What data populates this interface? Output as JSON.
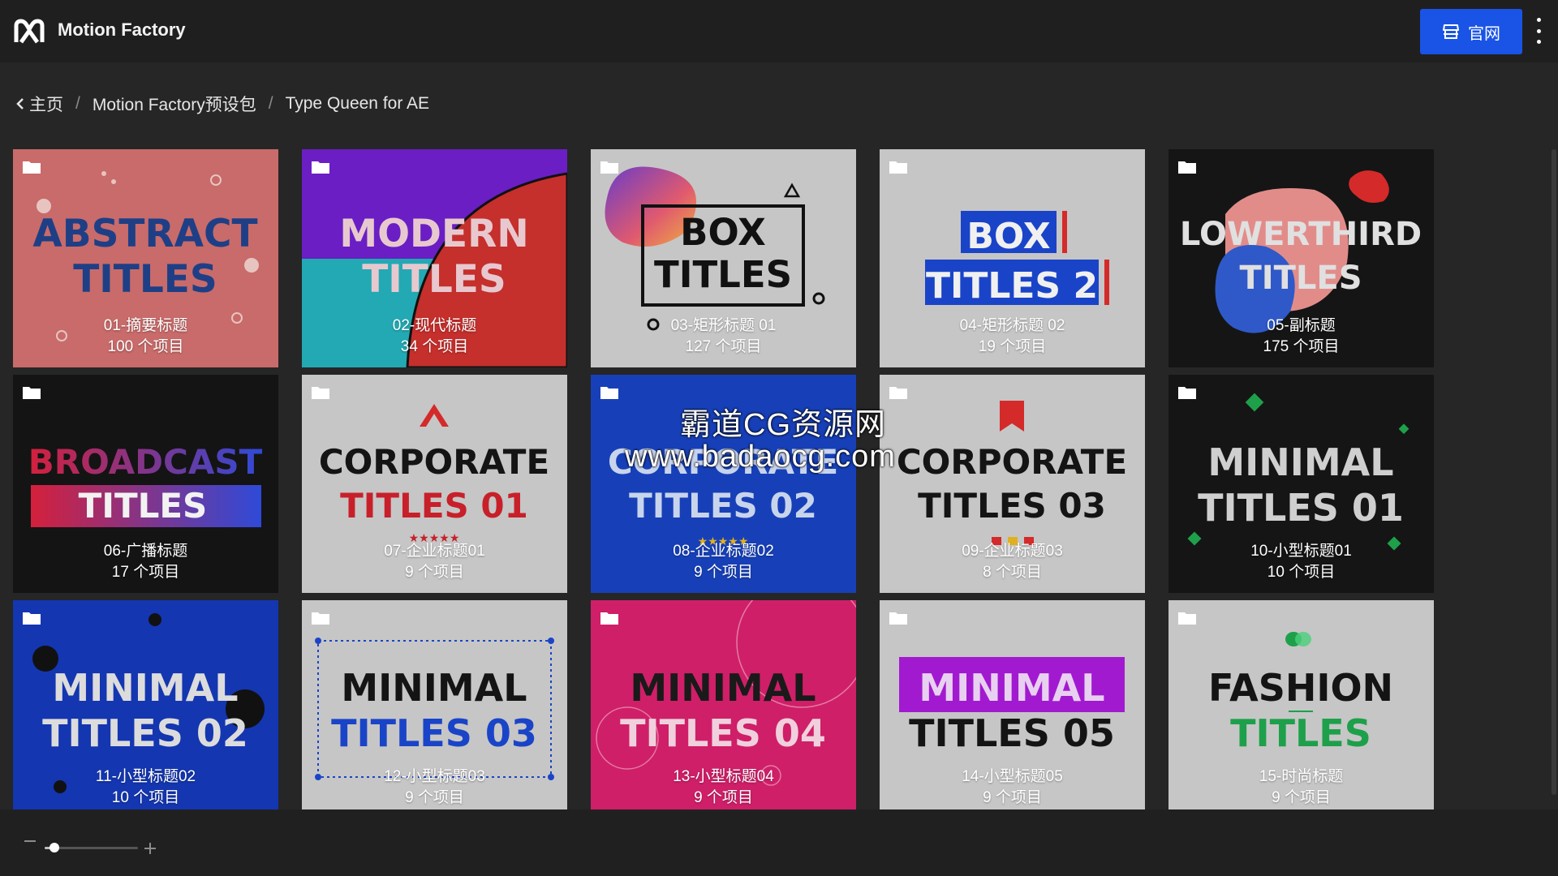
{
  "header": {
    "app_name": "Motion Factory",
    "site_button_label": "官网",
    "site_button_icon": "store-icon",
    "menu_icon": "more-vertical-icon",
    "accent_color": "#1a54e6"
  },
  "breadcrumb": {
    "back_icon": "chevron-left-icon",
    "home": "主页",
    "separator": "/",
    "level1": "Motion Factory预设包",
    "level2": "Type Queen for AE"
  },
  "folders": [
    {
      "name": "01-摘要标题",
      "count": "100 个项目",
      "art_line1": "ABSTRACT",
      "art_line2": "TITLES"
    },
    {
      "name": "02-现代标题",
      "count": "34 个项目",
      "art_line1": "MODERN",
      "art_line2": "TITLES"
    },
    {
      "name": "03-矩形标题 01",
      "count": "127 个项目",
      "art_line1": "BOX",
      "art_line2": "TITLES"
    },
    {
      "name": "04-矩形标题 02",
      "count": "19 个项目",
      "art_line1": "BOX",
      "art_line2": "TITLES 2"
    },
    {
      "name": "05-副标题",
      "count": "175 个项目",
      "art_line1": "LOWERTHIRD",
      "art_line2": "TITLES"
    },
    {
      "name": "06-广播标题",
      "count": "17 个项目",
      "art_line1": "BROADCAST",
      "art_line2": "TITLES"
    },
    {
      "name": "07-企业标题01",
      "count": "9 个项目",
      "art_line1": "CORPORATE",
      "art_line2": "TITLES 01"
    },
    {
      "name": "08-企业标题02",
      "count": "9 个项目",
      "art_line1": "CORPORATE",
      "art_line2": "TITLES 02"
    },
    {
      "name": "09-企业标题03",
      "count": "8 个项目",
      "art_line1": "CORPORATE",
      "art_line2": "TITLES 03"
    },
    {
      "name": "10-小型标题01",
      "count": "10 个项目",
      "art_line1": "MINIMAL",
      "art_line2": "TITLES 01"
    },
    {
      "name": "11-小型标题02",
      "count": "10 个项目",
      "art_line1": "MINIMAL",
      "art_line2": "TITLES 02"
    },
    {
      "name": "12-小型标题03",
      "count": "9 个项目",
      "art_line1": "MINIMAL",
      "art_line2": "TITLES 03"
    },
    {
      "name": "13-小型标题04",
      "count": "9 个项目",
      "art_line1": "MINIMAL",
      "art_line2": "TITLES 04"
    },
    {
      "name": "14-小型标题05",
      "count": "9 个项目",
      "art_line1": "MINIMAL",
      "art_line2": "TITLES 05"
    },
    {
      "name": "15-时尚标题",
      "count": "9 个项目",
      "art_line1": "FASHION",
      "art_line2": "TITLES"
    }
  ],
  "watermark": {
    "line1": "霸道CG资源网",
    "line2": "www.badaocg.com"
  },
  "footer": {
    "zoom_level": 0.1
  }
}
